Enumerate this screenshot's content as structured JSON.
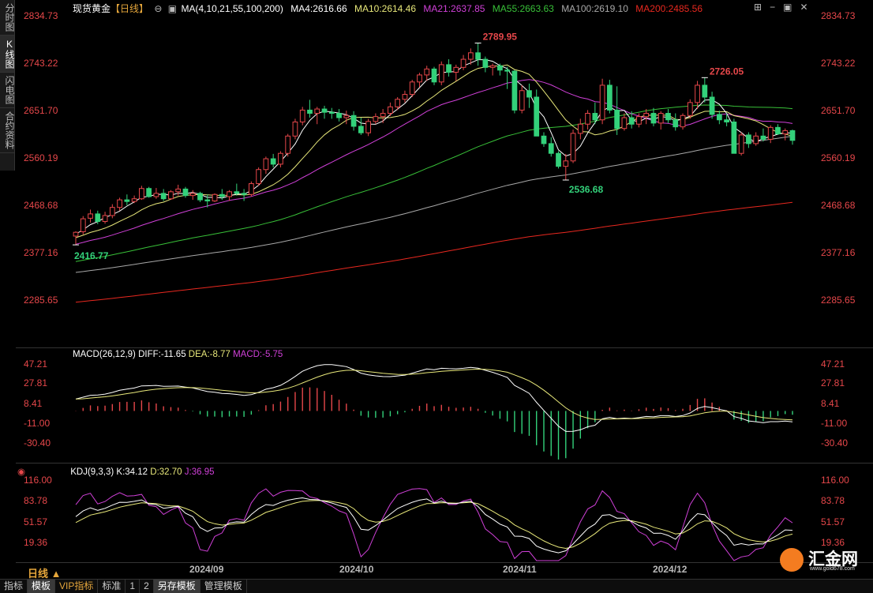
{
  "left_tabs": [
    {
      "label": "分时图",
      "active": false
    },
    {
      "label": "K线图",
      "active": true
    },
    {
      "label": "闪电图",
      "active": false
    },
    {
      "label": "合约资料",
      "active": false
    }
  ],
  "header": {
    "symbol": "现货黄金",
    "period_tag": "【日线】",
    "ma_params": "MA(4,10,21,55,100,200)",
    "ma4": "MA4:2616.66",
    "ma10": "MA10:2614.46",
    "ma21": "MA21:2637.85",
    "ma55": "MA55:2663.63",
    "ma100": "MA100:2619.10",
    "ma200": "MA200:2485.56"
  },
  "macd_header": {
    "title": "MACD(26,12,9)",
    "diff": "DIFF:-11.65",
    "dea": "DEA:-8.77",
    "macd": "MACD:-5.75"
  },
  "kdj_header": {
    "title": "KDJ(9,3,3)",
    "k": "K:34.12",
    "d": "D:32.70",
    "j": "J:36.95"
  },
  "price_axis": [
    "2834.73",
    "2743.22",
    "2651.70",
    "2560.19",
    "2468.68",
    "2377.16",
    "2285.65"
  ],
  "macd_axis": [
    "47.21",
    "27.81",
    "8.41",
    "-11.00",
    "-30.40"
  ],
  "kdj_axis": [
    "116.00",
    "83.78",
    "51.57",
    "19.36"
  ],
  "annotations": {
    "high": "2789.95",
    "low_start": "2416.77",
    "low_mid": "2536.68",
    "high2": "2726.05"
  },
  "dates": [
    "2024/09",
    "2024/10",
    "2024/11",
    "2024/12"
  ],
  "period_label": "日线 ▲",
  "bottom_bar": [
    {
      "label": "指标",
      "active": false
    },
    {
      "label": "模板",
      "active": true
    },
    {
      "label": "VIP指标",
      "active": false,
      "vip": true
    },
    {
      "label": "标准",
      "active": false
    },
    {
      "label": "1",
      "active": false
    },
    {
      "label": "2",
      "active": false
    },
    {
      "label": "另存模板",
      "active": true
    },
    {
      "label": "管理模板",
      "active": false
    }
  ],
  "watermark": {
    "text": "汇金网",
    "url": "www.gold678.com"
  },
  "colors": {
    "up": "#e6474a",
    "down": "#33d17a",
    "ma4": "#ffffff",
    "ma10": "#e8e87a",
    "ma21": "#d040d8",
    "ma55": "#38c038",
    "ma100": "#a8a8a8",
    "ma200": "#e8281f"
  },
  "chart_data": {
    "type": "candlestick",
    "ohlc": [
      [
        2433,
        2442,
        2417,
        2440
      ],
      [
        2441,
        2470,
        2436,
        2465
      ],
      [
        2466,
        2482,
        2458,
        2474
      ],
      [
        2474,
        2480,
        2455,
        2460
      ],
      [
        2460,
        2478,
        2456,
        2471
      ],
      [
        2471,
        2492,
        2466,
        2486
      ],
      [
        2486,
        2504,
        2480,
        2500
      ],
      [
        2500,
        2510,
        2490,
        2497
      ],
      [
        2497,
        2508,
        2494,
        2502
      ],
      [
        2502,
        2526,
        2500,
        2521
      ],
      [
        2521,
        2524,
        2504,
        2506
      ],
      [
        2506,
        2522,
        2502,
        2512
      ],
      [
        2512,
        2520,
        2498,
        2502
      ],
      [
        2502,
        2518,
        2500,
        2515
      ],
      [
        2515,
        2528,
        2508,
        2520
      ],
      [
        2520,
        2524,
        2504,
        2508
      ],
      [
        2508,
        2518,
        2500,
        2512
      ],
      [
        2512,
        2515,
        2496,
        2500
      ],
      [
        2500,
        2510,
        2486,
        2498
      ],
      [
        2498,
        2512,
        2496,
        2510
      ],
      [
        2510,
        2520,
        2500,
        2506
      ],
      [
        2506,
        2518,
        2498,
        2515
      ],
      [
        2515,
        2530,
        2508,
        2512
      ],
      [
        2512,
        2520,
        2498,
        2510
      ],
      [
        2510,
        2534,
        2506,
        2530
      ],
      [
        2530,
        2560,
        2526,
        2556
      ],
      [
        2556,
        2580,
        2548,
        2576
      ],
      [
        2576,
        2585,
        2560,
        2566
      ],
      [
        2566,
        2590,
        2560,
        2586
      ],
      [
        2586,
        2622,
        2580,
        2618
      ],
      [
        2618,
        2650,
        2612,
        2644
      ],
      [
        2644,
        2672,
        2638,
        2666
      ],
      [
        2666,
        2685,
        2652,
        2660
      ],
      [
        2660,
        2672,
        2640,
        2668
      ],
      [
        2668,
        2674,
        2650,
        2662
      ],
      [
        2662,
        2670,
        2650,
        2660
      ],
      [
        2660,
        2668,
        2645,
        2652
      ],
      [
        2652,
        2665,
        2640,
        2656
      ],
      [
        2656,
        2664,
        2628,
        2636
      ],
      [
        2636,
        2652,
        2620,
        2624
      ],
      [
        2624,
        2650,
        2618,
        2645
      ],
      [
        2645,
        2660,
        2640,
        2654
      ],
      [
        2654,
        2668,
        2642,
        2660
      ],
      [
        2660,
        2680,
        2655,
        2672
      ],
      [
        2672,
        2690,
        2666,
        2686
      ],
      [
        2686,
        2702,
        2680,
        2695
      ],
      [
        2695,
        2722,
        2690,
        2718
      ],
      [
        2718,
        2735,
        2708,
        2731
      ],
      [
        2731,
        2748,
        2720,
        2742
      ],
      [
        2742,
        2746,
        2712,
        2718
      ],
      [
        2718,
        2756,
        2712,
        2750
      ],
      [
        2750,
        2760,
        2728,
        2736
      ],
      [
        2736,
        2750,
        2720,
        2745
      ],
      [
        2745,
        2768,
        2740,
        2760
      ],
      [
        2760,
        2780,
        2750,
        2772
      ],
      [
        2772,
        2790,
        2748,
        2760
      ],
      [
        2760,
        2765,
        2736,
        2745
      ],
      [
        2745,
        2752,
        2730,
        2748
      ],
      [
        2748,
        2752,
        2730,
        2740
      ],
      [
        2740,
        2746,
        2705,
        2738
      ],
      [
        2738,
        2740,
        2660,
        2666
      ],
      [
        2666,
        2712,
        2660,
        2702
      ],
      [
        2702,
        2715,
        2670,
        2690
      ],
      [
        2690,
        2704,
        2628,
        2618
      ],
      [
        2618,
        2625,
        2598,
        2604
      ],
      [
        2604,
        2616,
        2580,
        2586
      ],
      [
        2586,
        2590,
        2558,
        2562
      ],
      [
        2562,
        2585,
        2537,
        2572
      ],
      [
        2572,
        2630,
        2568,
        2623
      ],
      [
        2623,
        2650,
        2612,
        2640
      ],
      [
        2640,
        2666,
        2630,
        2660
      ],
      [
        2660,
        2680,
        2640,
        2648
      ],
      [
        2648,
        2724,
        2640,
        2712
      ],
      [
        2712,
        2722,
        2660,
        2666
      ],
      [
        2666,
        2710,
        2620,
        2632
      ],
      [
        2632,
        2660,
        2628,
        2652
      ],
      [
        2652,
        2664,
        2632,
        2640
      ],
      [
        2640,
        2660,
        2634,
        2654
      ],
      [
        2654,
        2668,
        2640,
        2660
      ],
      [
        2660,
        2670,
        2636,
        2642
      ],
      [
        2642,
        2664,
        2630,
        2660
      ],
      [
        2660,
        2668,
        2642,
        2648
      ],
      [
        2648,
        2660,
        2628,
        2635
      ],
      [
        2635,
        2660,
        2630,
        2656
      ],
      [
        2656,
        2686,
        2650,
        2680
      ],
      [
        2680,
        2720,
        2668,
        2712
      ],
      [
        2712,
        2726,
        2680,
        2690
      ],
      [
        2690,
        2700,
        2650,
        2658
      ],
      [
        2658,
        2665,
        2640,
        2648
      ],
      [
        2648,
        2660,
        2636,
        2644
      ],
      [
        2644,
        2650,
        2600,
        2586
      ],
      [
        2586,
        2625,
        2582,
        2620
      ],
      [
        2620,
        2625,
        2596,
        2604
      ],
      [
        2604,
        2625,
        2600,
        2618
      ],
      [
        2618,
        2632,
        2608,
        2612
      ],
      [
        2612,
        2638,
        2605,
        2634
      ],
      [
        2634,
        2640,
        2620,
        2622
      ],
      [
        2622,
        2632,
        2610,
        2628
      ],
      [
        2628,
        2630,
        2602,
        2610
      ]
    ],
    "markers": {
      "high": {
        "index": 55,
        "value": 2789.95
      },
      "low_start": {
        "index": 0,
        "value": 2416.77
      },
      "low_mid": {
        "index": 67,
        "value": 2536.68
      },
      "high2": {
        "index": 86,
        "value": 2726.05
      }
    },
    "price_ylim": [
      2230,
      2855
    ],
    "macd_ylim": [
      -52,
      56
    ],
    "kdj_ylim": [
      -5,
      125
    ],
    "log_scale": false,
    "grid": false
  }
}
